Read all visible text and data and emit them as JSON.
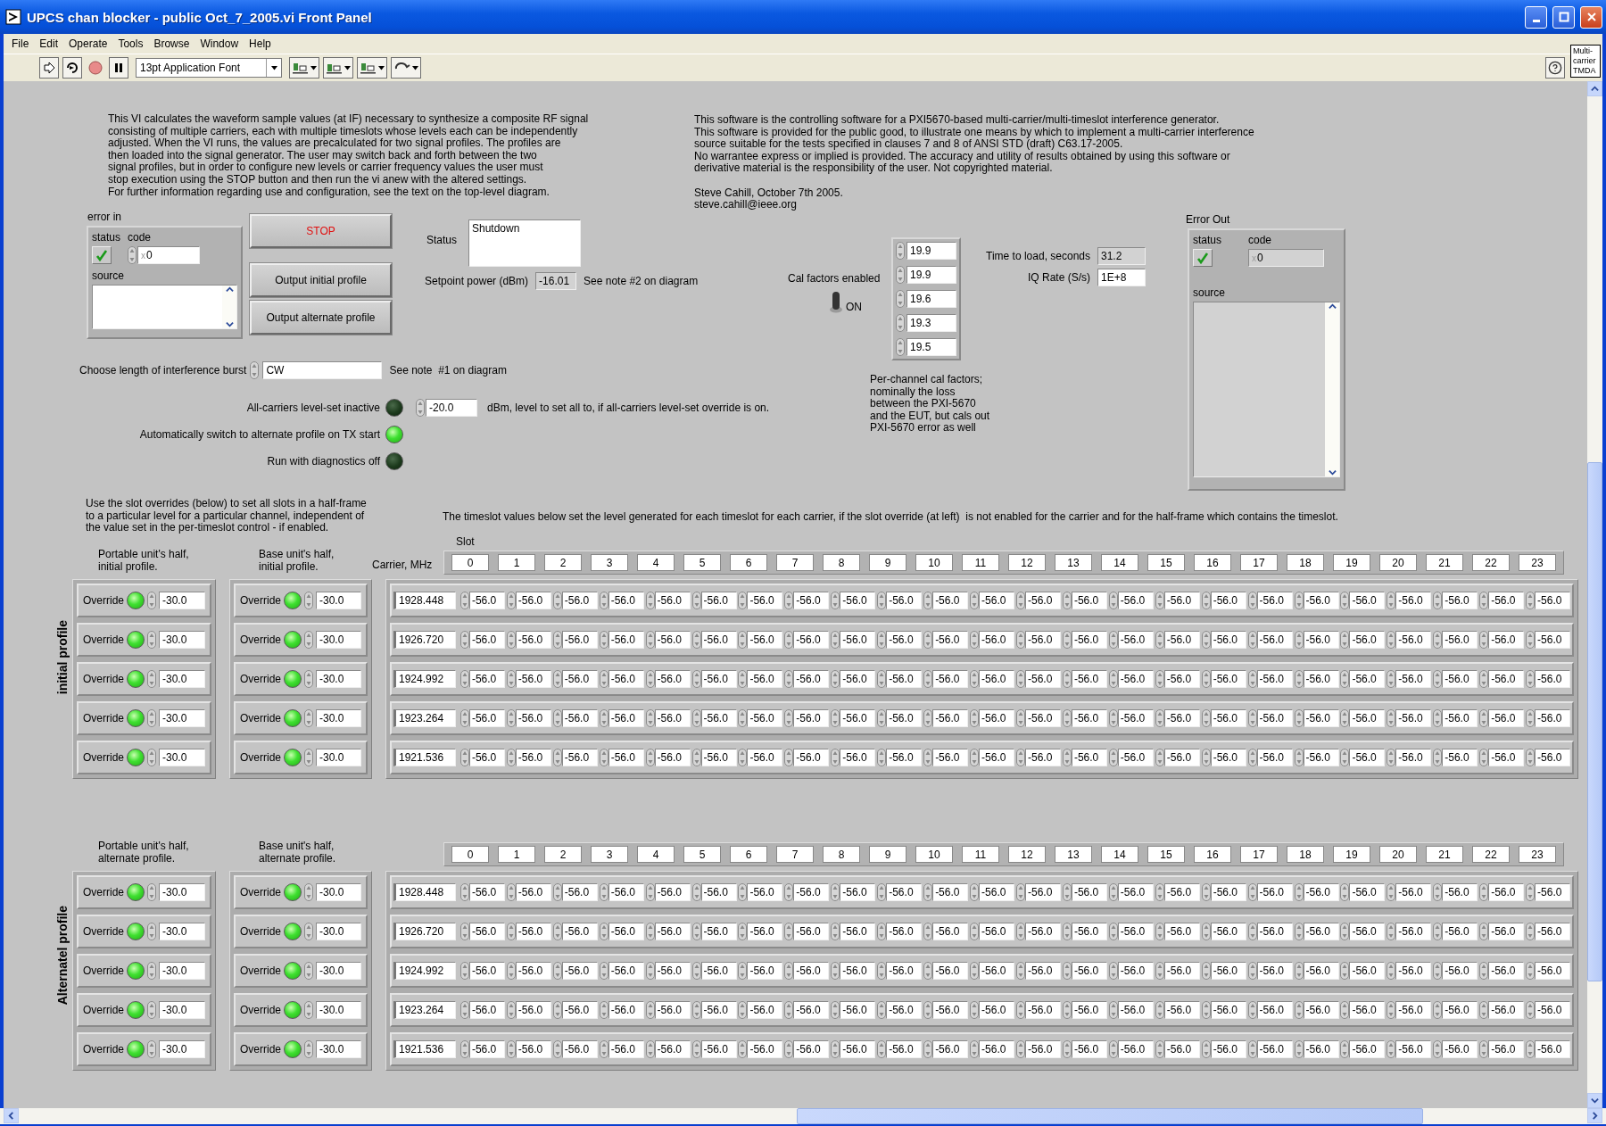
{
  "window": {
    "title": "UPCS chan blocker - public Oct_7_2005.vi Front Panel"
  },
  "menu": [
    "File",
    "Edit",
    "Operate",
    "Tools",
    "Browse",
    "Window",
    "Help"
  ],
  "toolbar": {
    "font": "13pt Application Font",
    "badge": "Multi- carrier TMDA"
  },
  "description": "This VI calculates the waveform sample values (at IF) necessary to synthesize a composite RF signal\nconsisting of multiple carriers, each with multiple timeslots whose levels each can be independently\nadjusted. When the VI runs, the values are precalculated for two signal profiles. The profiles are\nthen loaded into the signal generator. The user may switch back and forth between the two\nsignal profiles, but in order to configure new levels or carrier frequency values the user must\nstop execution using the STOP button and then run the vi anew with the altered settings.\nFor further information regarding use and configuration, see the text on the top-level diagram.",
  "about": "This software is the controlling software for a PXI5670-based multi-carrier/multi-timeslot interference generator.\nThis software is provided for the public good, to illustrate one means by which to implement a multi-carrier interference\nsource suitable for the tests specified in clauses 7 and 8 of ANSI STD (draft) C63.17-2005.\nNo warrantee express or implied is provided. The accuracy and utility of results obtained by using this software or\nderivative material is the responsibility of the user. Not copyrighted material.\n\nSteve Cahill, October 7th 2005.\nsteve.cahill@ieee.org",
  "error_in": {
    "label": "error in",
    "status_label": "status",
    "status": true,
    "code_label": "code",
    "radix": "x",
    "code": "0",
    "source_label": "source"
  },
  "buttons": [
    {
      "label": "STOP",
      "kind": "stop"
    },
    {
      "label": "Output initial profile",
      "kind": "normal"
    },
    {
      "label": "Output alternate profile",
      "kind": "normal"
    }
  ],
  "status": {
    "label": "Status",
    "value": "Shutdown"
  },
  "setpoint": {
    "label": "Setpoint power (dBm)",
    "value": "-16.01",
    "note": "See note #2 on diagram"
  },
  "burst": {
    "label": "Choose length of interference burst",
    "value": "CW",
    "note": "See note  #1 on diagram"
  },
  "leds": [
    {
      "label": "All-carriers level-set inactive",
      "on": false,
      "value": "-20.0",
      "note": "dBm, level to set all to, if all-carriers level-set override is on."
    },
    {
      "label": "Automatically switch to alternate profile on TX start",
      "on": true
    },
    {
      "label": "Run with diagnostics off",
      "on": false
    }
  ],
  "cal": {
    "label": "Cal factors enabled",
    "on": true,
    "on_label": "ON",
    "values": [
      "19.9",
      "19.9",
      "19.6",
      "19.3",
      "19.5"
    ],
    "note": "Per-channel cal factors;\nnominally the loss\nbetween the PXI-5670\nand the EUT, but cals out\nPXI-5670 error as well"
  },
  "readouts": [
    {
      "label": "Time to load, seconds",
      "value": "31.2",
      "kind": "indicator"
    },
    {
      "label": "IQ Rate (S/s)",
      "value": "1E+8",
      "kind": "control"
    }
  ],
  "error_out": {
    "label": "Error Out",
    "status_label": "status",
    "status": true,
    "code_label": "code",
    "radix": "x",
    "code": "0",
    "source_label": "source"
  },
  "override_note": "Use the slot overrides (below) to set all slots in a half-frame\nto a particular level for a particular channel, independent of\nthe value set in the per-timeslot control - if enabled.",
  "timeslot_note": "The timeslot values below set the level generated for each timeslot for each carrier, if the slot override (at left)  is not enabled for the carrier and for the half-frame which contains the timeslot.",
  "profiles": [
    {
      "title": "initial profile",
      "slot_label": "Slot",
      "portable_label": "Portable unit's half,\ninitial profile.",
      "base_label": "Base unit's half,\ninitial profile.",
      "carrier_label": "Carrier, MHz",
      "slots": [
        "0",
        "1",
        "2",
        "3",
        "4",
        "5",
        "6",
        "7",
        "8",
        "9",
        "10",
        "11",
        "12",
        "13",
        "14",
        "15",
        "16",
        "17",
        "18",
        "19",
        "20",
        "21",
        "22",
        "23"
      ],
      "rows": [
        {
          "portable": {
            "label": "Override",
            "on": true,
            "value": "-30.0"
          },
          "base": {
            "label": "Override",
            "on": true,
            "value": "-30.0"
          },
          "carrier": "1928.448",
          "levels": [
            "-56.0",
            "-56.0",
            "-56.0",
            "-56.0",
            "-56.0",
            "-56.0",
            "-56.0",
            "-56.0",
            "-56.0",
            "-56.0",
            "-56.0",
            "-56.0",
            "-56.0",
            "-56.0",
            "-56.0",
            "-56.0",
            "-56.0",
            "-56.0",
            "-56.0",
            "-56.0",
            "-56.0",
            "-56.0",
            "-56.0",
            "-56.0"
          ]
        },
        {
          "portable": {
            "label": "Override",
            "on": true,
            "value": "-30.0"
          },
          "base": {
            "label": "Override",
            "on": true,
            "value": "-30.0"
          },
          "carrier": "1926.720",
          "levels": [
            "-56.0",
            "-56.0",
            "-56.0",
            "-56.0",
            "-56.0",
            "-56.0",
            "-56.0",
            "-56.0",
            "-56.0",
            "-56.0",
            "-56.0",
            "-56.0",
            "-56.0",
            "-56.0",
            "-56.0",
            "-56.0",
            "-56.0",
            "-56.0",
            "-56.0",
            "-56.0",
            "-56.0",
            "-56.0",
            "-56.0",
            "-56.0"
          ]
        },
        {
          "portable": {
            "label": "Override",
            "on": true,
            "value": "-30.0"
          },
          "base": {
            "label": "Override",
            "on": true,
            "value": "-30.0"
          },
          "carrier": "1924.992",
          "levels": [
            "-56.0",
            "-56.0",
            "-56.0",
            "-56.0",
            "-56.0",
            "-56.0",
            "-56.0",
            "-56.0",
            "-56.0",
            "-56.0",
            "-56.0",
            "-56.0",
            "-56.0",
            "-56.0",
            "-56.0",
            "-56.0",
            "-56.0",
            "-56.0",
            "-56.0",
            "-56.0",
            "-56.0",
            "-56.0",
            "-56.0",
            "-56.0"
          ]
        },
        {
          "portable": {
            "label": "Override",
            "on": true,
            "value": "-30.0"
          },
          "base": {
            "label": "Override",
            "on": true,
            "value": "-30.0"
          },
          "carrier": "1923.264",
          "levels": [
            "-56.0",
            "-56.0",
            "-56.0",
            "-56.0",
            "-56.0",
            "-56.0",
            "-56.0",
            "-56.0",
            "-56.0",
            "-56.0",
            "-56.0",
            "-56.0",
            "-56.0",
            "-56.0",
            "-56.0",
            "-56.0",
            "-56.0",
            "-56.0",
            "-56.0",
            "-56.0",
            "-56.0",
            "-56.0",
            "-56.0",
            "-56.0"
          ]
        },
        {
          "portable": {
            "label": "Override",
            "on": true,
            "value": "-30.0"
          },
          "base": {
            "label": "Override",
            "on": true,
            "value": "-30.0"
          },
          "carrier": "1921.536",
          "levels": [
            "-56.0",
            "-56.0",
            "-56.0",
            "-56.0",
            "-56.0",
            "-56.0",
            "-56.0",
            "-56.0",
            "-56.0",
            "-56.0",
            "-56.0",
            "-56.0",
            "-56.0",
            "-56.0",
            "-56.0",
            "-56.0",
            "-56.0",
            "-56.0",
            "-56.0",
            "-56.0",
            "-56.0",
            "-56.0",
            "-56.0",
            "-56.0"
          ]
        }
      ]
    },
    {
      "title": "Alternatel profile",
      "portable_label": "Portable unit's half,\nalternate profile.",
      "base_label": "Base unit's half,\nalternate profile.",
      "slots": [
        "0",
        "1",
        "2",
        "3",
        "4",
        "5",
        "6",
        "7",
        "8",
        "9",
        "10",
        "11",
        "12",
        "13",
        "14",
        "15",
        "16",
        "17",
        "18",
        "19",
        "20",
        "21",
        "22",
        "23"
      ],
      "rows": [
        {
          "portable": {
            "label": "Override",
            "on": true,
            "value": "-30.0"
          },
          "base": {
            "label": "Override",
            "on": true,
            "value": "-30.0"
          },
          "carrier": "1928.448",
          "levels": [
            "-56.0",
            "-56.0",
            "-56.0",
            "-56.0",
            "-56.0",
            "-56.0",
            "-56.0",
            "-56.0",
            "-56.0",
            "-56.0",
            "-56.0",
            "-56.0",
            "-56.0",
            "-56.0",
            "-56.0",
            "-56.0",
            "-56.0",
            "-56.0",
            "-56.0",
            "-56.0",
            "-56.0",
            "-56.0",
            "-56.0",
            "-56.0"
          ]
        },
        {
          "portable": {
            "label": "Override",
            "on": true,
            "value": "-30.0"
          },
          "base": {
            "label": "Override",
            "on": true,
            "value": "-30.0"
          },
          "carrier": "1926.720",
          "levels": [
            "-56.0",
            "-56.0",
            "-56.0",
            "-56.0",
            "-56.0",
            "-56.0",
            "-56.0",
            "-56.0",
            "-56.0",
            "-56.0",
            "-56.0",
            "-56.0",
            "-56.0",
            "-56.0",
            "-56.0",
            "-56.0",
            "-56.0",
            "-56.0",
            "-56.0",
            "-56.0",
            "-56.0",
            "-56.0",
            "-56.0",
            "-56.0"
          ]
        },
        {
          "portable": {
            "label": "Override",
            "on": true,
            "value": "-30.0"
          },
          "base": {
            "label": "Override",
            "on": true,
            "value": "-30.0"
          },
          "carrier": "1924.992",
          "levels": [
            "-56.0",
            "-56.0",
            "-56.0",
            "-56.0",
            "-56.0",
            "-56.0",
            "-56.0",
            "-56.0",
            "-56.0",
            "-56.0",
            "-56.0",
            "-56.0",
            "-56.0",
            "-56.0",
            "-56.0",
            "-56.0",
            "-56.0",
            "-56.0",
            "-56.0",
            "-56.0",
            "-56.0",
            "-56.0",
            "-56.0",
            "-56.0"
          ]
        },
        {
          "portable": {
            "label": "Override",
            "on": true,
            "value": "-30.0"
          },
          "base": {
            "label": "Override",
            "on": true,
            "value": "-30.0"
          },
          "carrier": "1923.264",
          "levels": [
            "-56.0",
            "-56.0",
            "-56.0",
            "-56.0",
            "-56.0",
            "-56.0",
            "-56.0",
            "-56.0",
            "-56.0",
            "-56.0",
            "-56.0",
            "-56.0",
            "-56.0",
            "-56.0",
            "-56.0",
            "-56.0",
            "-56.0",
            "-56.0",
            "-56.0",
            "-56.0",
            "-56.0",
            "-56.0",
            "-56.0",
            "-56.0"
          ]
        },
        {
          "portable": {
            "label": "Override",
            "on": true,
            "value": "-30.0"
          },
          "base": {
            "label": "Override",
            "on": true,
            "value": "-30.0"
          },
          "carrier": "1921.536",
          "levels": [
            "-56.0",
            "-56.0",
            "-56.0",
            "-56.0",
            "-56.0",
            "-56.0",
            "-56.0",
            "-56.0",
            "-56.0",
            "-56.0",
            "-56.0",
            "-56.0",
            "-56.0",
            "-56.0",
            "-56.0",
            "-56.0",
            "-56.0",
            "-56.0",
            "-56.0",
            "-56.0",
            "-56.0",
            "-56.0",
            "-56.0",
            "-56.0"
          ]
        }
      ]
    }
  ]
}
